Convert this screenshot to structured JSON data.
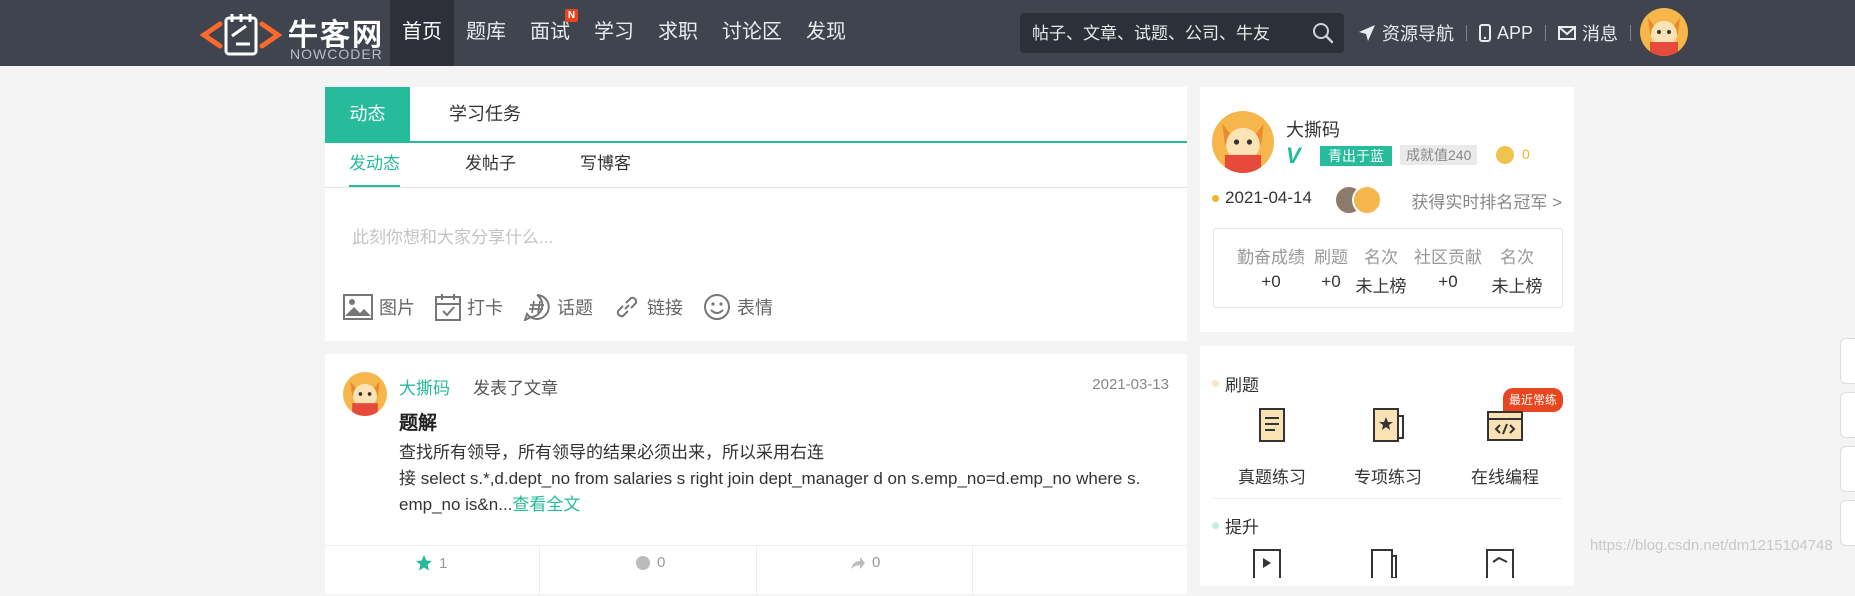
{
  "colors": {
    "accent": "#25bb9b",
    "nav_bg": "#3f444f",
    "hot": "#e8461e",
    "coin": "#f0b428"
  },
  "brand": {
    "name": "牛客网",
    "name_en": "NOWCODER"
  },
  "nav": {
    "items": [
      {
        "label": "首页",
        "active": true
      },
      {
        "label": "题库"
      },
      {
        "label": "面试",
        "badge": "N"
      },
      {
        "label": "学习"
      },
      {
        "label": "求职"
      },
      {
        "label": "讨论区"
      },
      {
        "label": "发现"
      }
    ]
  },
  "search": {
    "placeholder": "帖子、文章、试题、公司、牛友",
    "icon": "search-icon"
  },
  "toplinks": {
    "resources": "资源导航",
    "app": "APP",
    "messages": "消息"
  },
  "composer": {
    "tabs": [
      "动态",
      "学习任务"
    ],
    "subtabs": [
      "发动态",
      "发帖子",
      "写博客"
    ],
    "placeholder": "此刻你想和大家分享什么...",
    "tools": [
      "图片",
      "打卡",
      "话题",
      "链接",
      "表情"
    ]
  },
  "feed": {
    "author": "大撕码",
    "action": "发表了文章",
    "date": "2021-03-13",
    "title": "题解",
    "line1": "查找所有领导，所有领导的结果必须出来，所以采用右连",
    "line2": "接 select s.*,d.dept_no from salaries s right join dept_manager d on s.emp_no=d.emp_no where s.",
    "line3": "emp_no is&n...",
    "more": "查看全文",
    "like_count": "1",
    "comment_count": "0",
    "share_count": "0"
  },
  "profile": {
    "name": "大撕码",
    "level": "青出于蓝",
    "score": "成就值240",
    "coins": "0",
    "date": "2021-04-14",
    "rank_link": "获得实时排名冠军 >",
    "stats": [
      {
        "label": "勤奋成绩",
        "value": "+0"
      },
      {
        "label": "刷题",
        "value": "+0"
      },
      {
        "label": "名次",
        "value": "未上榜"
      },
      {
        "label": "社区贡献",
        "value": "+0"
      },
      {
        "label": "名次",
        "value": "未上榜"
      }
    ]
  },
  "practice": {
    "section1": "刷题",
    "items": [
      "真题练习",
      "专项练习",
      "在线编程"
    ],
    "hot_tag": "最近常练",
    "section2": "提升"
  },
  "watermark": "https://blog.csdn.net/dm1215104748"
}
